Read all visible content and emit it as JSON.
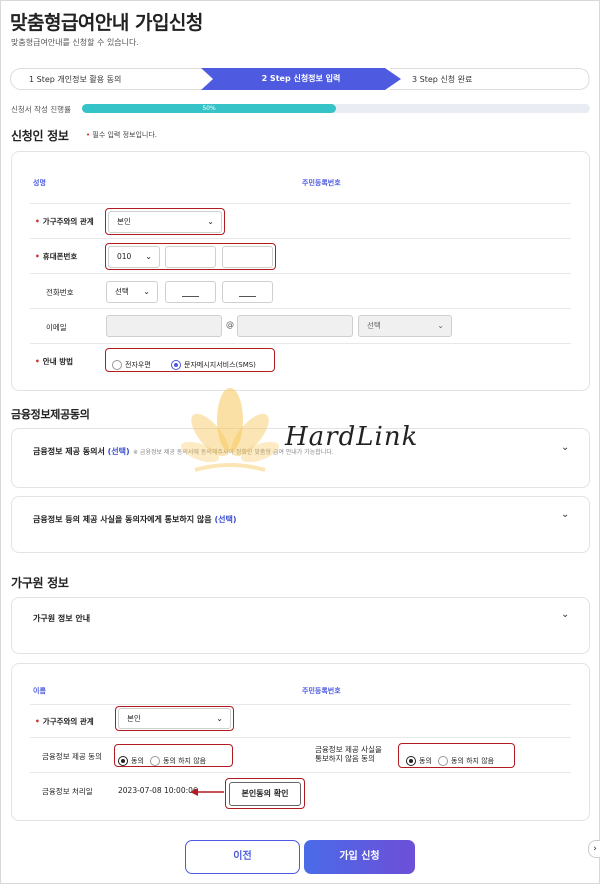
{
  "header": {
    "title": "맞춤형급여안내 가입신청",
    "subtitle": "맞춤형급여안내를 신청할 수 있습니다."
  },
  "steps": [
    {
      "label": "1 Step 개인정보 활용 동의",
      "active": false
    },
    {
      "label": "2 Step 신청정보 입력",
      "active": true
    },
    {
      "label": "3 Step 신청 완료",
      "active": false
    }
  ],
  "progress": {
    "label": "신청서 작성 진행률",
    "value_label": "50%",
    "value": 0.5
  },
  "applicant": {
    "section_title": "신청인 정보",
    "required_note": "필수 입력 정보입니다.",
    "col_name": "성명",
    "col_rrn": "주민등록번호",
    "relation_label": "가구주와의 관계",
    "relation_value": "본인",
    "mobile_label": "휴대폰번호",
    "mobile_prefix": "010",
    "phone_label": "전화번호",
    "phone_prefix": "선택",
    "email_label": "이메일",
    "email_at": "@",
    "email_domain": "선택",
    "notify_label": "안내 방법",
    "notify_opt1": "전자우편",
    "notify_opt2": "문자메시지서비스(SMS)"
  },
  "financial": {
    "section_title": "금융정보제공동의",
    "consent1_title": "금융정보 제공 동의서",
    "consent1_opt": "(선택)",
    "consent1_note": "※ 금융정보 제공 동의서에 동의해주셔야 정확한 맞춤형 급여 안내가 가능합니다.",
    "consent2_title": "금융정보 등의 제공 사실을 동의자에게 통보하지 않음",
    "consent2_opt": "(선택)"
  },
  "household": {
    "section_title": "가구원 정보",
    "info_title": "가구원 정보 안내",
    "col_name": "이름",
    "col_rrn": "주민등록번호",
    "relation_label": "가구주와의 관계",
    "relation_value": "본인",
    "fin_consent_label": "금융정보 제공 동의",
    "agree": "동의",
    "disagree": "동의 하지 않음",
    "notify_label_line1": "금융정보 제공 사실을",
    "notify_label_line2": "통보하지 않음 동의",
    "processed_label": "금융정보 처리일",
    "processed_value": "2023-07-08 10:00:06",
    "confirm_button": "본인동의 확인"
  },
  "buttons": {
    "prev": "이전",
    "submit": "가입 신청"
  },
  "watermark": {
    "text": "HardLink"
  },
  "colors": {
    "accent": "#4e5be0",
    "progress": "#36c3c7",
    "highlight": "#b11c22",
    "required": "#d0302c"
  }
}
